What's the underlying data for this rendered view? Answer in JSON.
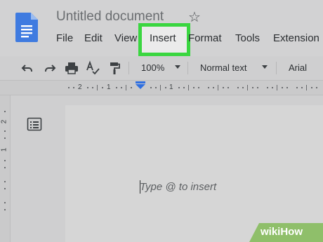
{
  "app": {
    "doc_title": "Untitled document",
    "star_icon": "star-icon",
    "logo_icon": "google-docs-icon"
  },
  "menu": {
    "items": [
      "File",
      "Edit",
      "View",
      "Insert",
      "Format",
      "Tools",
      "Extension"
    ],
    "highlighted": "Insert",
    "highlight_color": "#3ad640"
  },
  "toolbar": {
    "icons": [
      "undo-icon",
      "redo-icon",
      "print-icon",
      "spellcheck-icon",
      "paint-format-icon"
    ],
    "zoom": "100%",
    "style": "Normal text",
    "font": "Arial"
  },
  "ruler": {
    "numbers": [
      "2",
      "1",
      "1"
    ]
  },
  "vruler": {
    "numbers": [
      "2",
      "1"
    ]
  },
  "document": {
    "placeholder": "Type @ to insert"
  },
  "watermark": {
    "text": "wikiHow",
    "color": "#8fbf6a"
  }
}
